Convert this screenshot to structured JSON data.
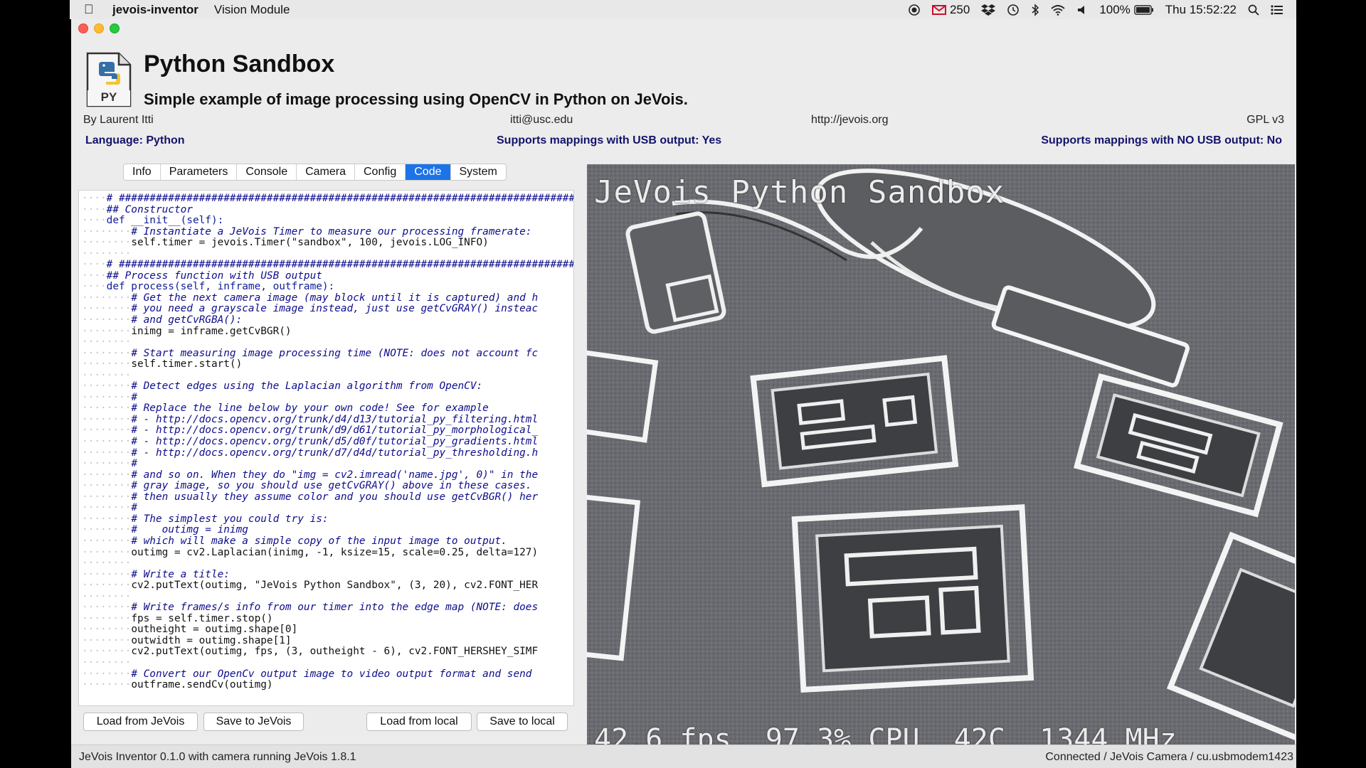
{
  "menubar": {
    "app_name": "jevois-inventor",
    "menu": "Vision Module",
    "mail_count": "250",
    "battery": "100%",
    "clock": "Thu 15:52:22"
  },
  "header": {
    "icon_label": "PY",
    "title": "Python Sandbox",
    "subtitle": "Simple example of image processing using OpenCV in Python on JeVois.",
    "author": "By Laurent Itti",
    "email": "itti@usc.edu",
    "website": "http://jevois.org",
    "license": "GPL v3",
    "language": "Language: Python",
    "usb_support": "Supports mappings with USB output: Yes",
    "nousb_support": "Supports mappings with NO USB output: No"
  },
  "tabs": [
    "Info",
    "Parameters",
    "Console",
    "Camera",
    "Config",
    "Code",
    "System"
  ],
  "active_tab": "Code",
  "code_lines": [
    {
      "ind": "····",
      "c": "# ##############################################################################"
    },
    {
      "ind": "····",
      "c": "## Constructor"
    },
    {
      "ind": "····",
      "c": "def __init__(self):"
    },
    {
      "ind": "········",
      "c": "# Instantiate a JeVois Timer to measure our processing framerate:"
    },
    {
      "ind": "········",
      "c": "self.timer = jevois.Timer(\"sandbox\", 100, jevois.LOG_INFO)"
    },
    {
      "ind": "········",
      "c": ""
    },
    {
      "ind": "····",
      "c": "# ##############################################################################"
    },
    {
      "ind": "····",
      "c": "## Process function with USB output"
    },
    {
      "ind": "····",
      "c": "def process(self, inframe, outframe):"
    },
    {
      "ind": "········",
      "c": "# Get the next camera image (may block until it is captured) and h"
    },
    {
      "ind": "········",
      "c": "# you need a grayscale image instead, just use getCvGRAY() insteac"
    },
    {
      "ind": "········",
      "c": "# and getCvRGBA():"
    },
    {
      "ind": "········",
      "c": "inimg = inframe.getCvBGR()"
    },
    {
      "ind": "········",
      "c": ""
    },
    {
      "ind": "········",
      "c": "# Start measuring image processing time (NOTE: does not account fc"
    },
    {
      "ind": "········",
      "c": "self.timer.start()"
    },
    {
      "ind": "········",
      "c": ""
    },
    {
      "ind": "········",
      "c": "# Detect edges using the Laplacian algorithm from OpenCV:"
    },
    {
      "ind": "········",
      "c": "#"
    },
    {
      "ind": "········",
      "c": "# Replace the line below by your own code! See for example"
    },
    {
      "ind": "········",
      "c": "# - http://docs.opencv.org/trunk/d4/d13/tutorial_py_filtering.html"
    },
    {
      "ind": "········",
      "c": "# - http://docs.opencv.org/trunk/d9/d61/tutorial_py_morphological_"
    },
    {
      "ind": "········",
      "c": "# - http://docs.opencv.org/trunk/d5/d0f/tutorial_py_gradients.html"
    },
    {
      "ind": "········",
      "c": "# - http://docs.opencv.org/trunk/d7/d4d/tutorial_py_thresholding.h"
    },
    {
      "ind": "········",
      "c": "#"
    },
    {
      "ind": "········",
      "c": "# and so on. When they do \"img = cv2.imread('name.jpg', 0)\" in the"
    },
    {
      "ind": "········",
      "c": "# gray image, so you should use getCvGRAY() above in these cases."
    },
    {
      "ind": "········",
      "c": "# then usually they assume color and you should use getCvBGR() her"
    },
    {
      "ind": "········",
      "c": "#"
    },
    {
      "ind": "········",
      "c": "# The simplest you could try is:"
    },
    {
      "ind": "········",
      "c": "#    outimg = inimg"
    },
    {
      "ind": "········",
      "c": "# which will make a simple copy of the input image to output."
    },
    {
      "ind": "········",
      "c": "outimg = cv2.Laplacian(inimg, -1, ksize=15, scale=0.25, delta=127)"
    },
    {
      "ind": "········",
      "c": ""
    },
    {
      "ind": "········",
      "c": "# Write a title:"
    },
    {
      "ind": "········",
      "c": "cv2.putText(outimg, \"JeVois Python Sandbox\", (3, 20), cv2.FONT_HER"
    },
    {
      "ind": "········",
      "c": ""
    },
    {
      "ind": "········",
      "c": "# Write frames/s info from our timer into the edge map (NOTE: does"
    },
    {
      "ind": "········",
      "c": "fps = self.timer.stop()"
    },
    {
      "ind": "········",
      "c": "outheight = outimg.shape[0]"
    },
    {
      "ind": "········",
      "c": "outwidth = outimg.shape[1]"
    },
    {
      "ind": "········",
      "c": "cv2.putText(outimg, fps, (3, outheight - 6), cv2.FONT_HERSHEY_SIMF"
    },
    {
      "ind": "········",
      "c": ""
    },
    {
      "ind": "········",
      "c": "# Convert our OpenCv output image to video output format and send"
    },
    {
      "ind": "········",
      "c": "outframe.sendCv(outimg)"
    }
  ],
  "buttons": {
    "load_jevois": "Load from JeVois",
    "save_jevois": "Save to JeVois",
    "load_local": "Load from local",
    "save_local": "Save to local"
  },
  "camera": {
    "overlay_title": "JeVois Python Sandbox",
    "overlay_stats": "42.6 fps, 97.3% CPU, 42C, 1344 MHz"
  },
  "status": {
    "left": "JeVois Inventor 0.1.0 with camera running JeVois 1.8.1",
    "right": "Connected / JeVois Camera / cu.usbmodem1423"
  },
  "colors": {
    "accent": "#1d73e8",
    "close": "#fd5f57",
    "minimize": "#febc2e",
    "zoom": "#28c840",
    "support_text": "#13136b"
  }
}
